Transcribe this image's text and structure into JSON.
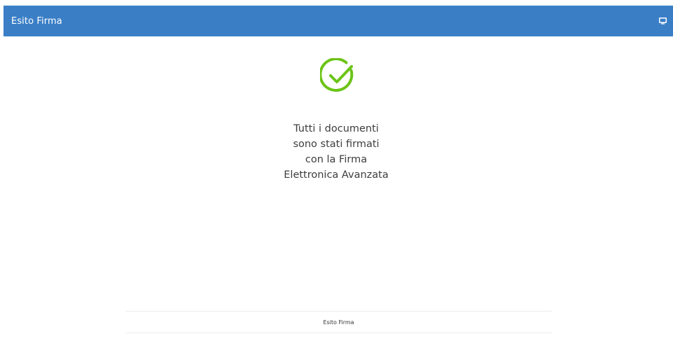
{
  "header": {
    "title": "Esito Firma",
    "action_icon": "monitor-icon",
    "background_color": "#3a7fc6"
  },
  "status": {
    "icon": "check-circle-icon",
    "icon_color": "#6cc417",
    "message_lines": [
      "Tutti i documenti",
      "sono stati firmati",
      "con la Firma",
      "Elettronica Avanzata"
    ]
  },
  "footer": {
    "label": "Esito Firma"
  }
}
